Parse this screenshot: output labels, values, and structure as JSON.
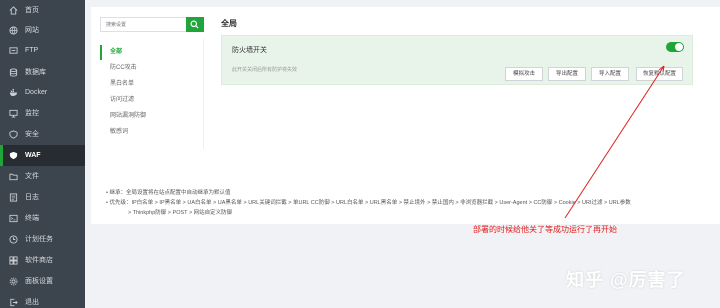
{
  "sidebar": {
    "items": [
      {
        "label": "首页",
        "icon": "home-icon"
      },
      {
        "label": "网站",
        "icon": "globe-icon"
      },
      {
        "label": "FTP",
        "icon": "ftp-icon"
      },
      {
        "label": "数据库",
        "icon": "database-icon"
      },
      {
        "label": "Docker",
        "icon": "docker-icon"
      },
      {
        "label": "监控",
        "icon": "monitor-icon"
      },
      {
        "label": "安全",
        "icon": "shield-icon"
      },
      {
        "label": "WAF",
        "icon": "waf-icon",
        "active": true
      },
      {
        "label": "文件",
        "icon": "folder-icon"
      },
      {
        "label": "日志",
        "icon": "log-icon"
      },
      {
        "label": "终端",
        "icon": "terminal-icon"
      },
      {
        "label": "计划任务",
        "icon": "clock-icon"
      },
      {
        "label": "软件商店",
        "icon": "store-icon"
      },
      {
        "label": "面板设置",
        "icon": "settings-icon"
      },
      {
        "label": "退出",
        "icon": "exit-icon"
      }
    ]
  },
  "search": {
    "placeholder": "搜索设置"
  },
  "left_menu": {
    "items": [
      "全部",
      "防CC攻击",
      "黑白名单",
      "访问过滤",
      "网站漏洞防御",
      "敏感词"
    ]
  },
  "main": {
    "section_title": "全局",
    "firewall": {
      "title": "防火墙开关",
      "description": "此开关关闭后所有防护将失效",
      "enabled": true,
      "buttons": [
        "模拟攻击",
        "导出配置",
        "导入配置",
        "恢复默认配置"
      ]
    }
  },
  "notes": {
    "line1": "• 继承：全局设置将在站点配置中自动继承为默认值",
    "line2": "• 优先级：IP白名单 > IP黑名单 > UA白名单 > UA黑名单 > URL关键词拦截 > 单URL CC防御 > URL白名单 > URL黑名单 > 禁止境外 > 禁止国内 > 非浏览器拦截 > User-Agent > CC防御 > Cookie > URI过滤 > URL参数",
    "line3": "> Thinkphp防御 > POST > 网站自定义防御"
  },
  "annotation": {
    "text": "部署的时候给他关了等成功运行了再开始",
    "color": "#e02020"
  },
  "watermark": {
    "text": "知乎 @厉害了"
  },
  "colors": {
    "sidebar_bg": "#3c444d",
    "accent": "#20a53a",
    "panel_bg": "#e8f4ea"
  }
}
